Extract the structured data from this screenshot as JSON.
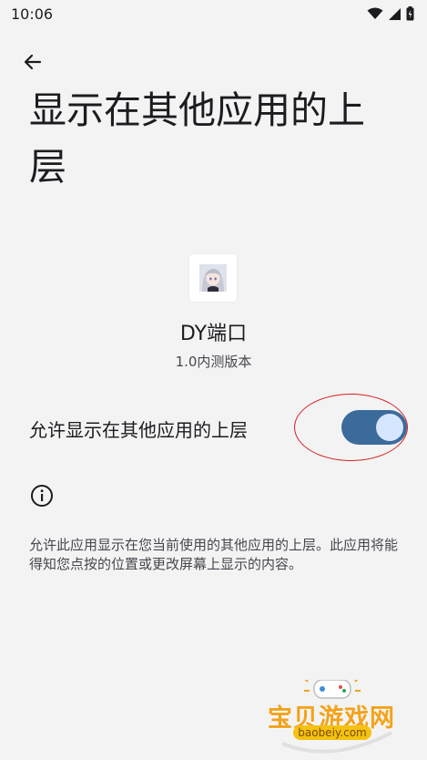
{
  "status_bar": {
    "time": "10:06",
    "icons": [
      "wifi-icon",
      "signal-icon",
      "battery-icon"
    ]
  },
  "header": {
    "back_icon": "arrow-back-icon",
    "title": "显示在其他应用的上层"
  },
  "app": {
    "name": "DY端口",
    "version": "1.0内测版本",
    "icon": "anime-avatar-icon"
  },
  "permission": {
    "label": "允许显示在其他应用的上层",
    "enabled": true
  },
  "info": {
    "icon": "info-icon",
    "description": "允许此应用显示在您当前使用的其他应用的上层。此应用将能得知您点按的位置或更改屏幕上显示的内容。"
  },
  "watermark": {
    "text": "宝贝游戏网",
    "url": "baobeiy.com"
  },
  "colors": {
    "background": "#f3f3f3",
    "switch_track": "#3b6b9b",
    "switch_thumb": "#d6e6ff",
    "annotation": "#d62020",
    "watermark": "#f3a21b"
  }
}
